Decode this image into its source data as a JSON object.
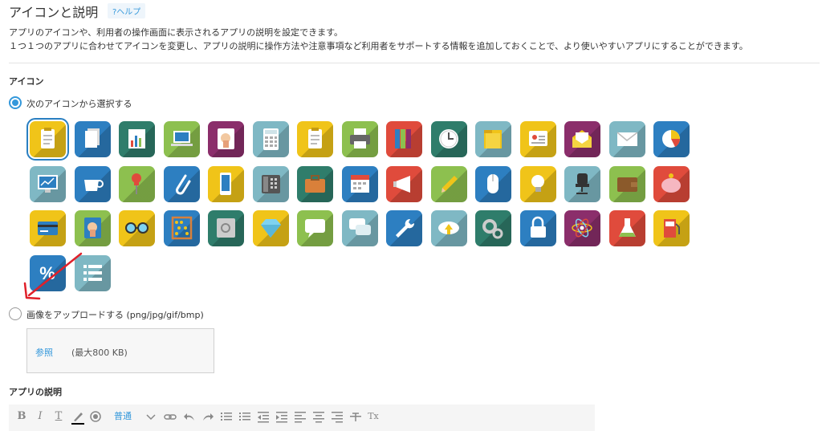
{
  "header": {
    "title": "アイコンと説明",
    "help_label": "?ヘルプ"
  },
  "description": {
    "line1": "アプリのアイコンや、利用者の操作画面に表示されるアプリの説明を設定できます。",
    "line2": "１つ１つのアプリに合わせてアイコンを変更し、アプリの説明に操作方法や注意事項など利用者をサポートする情報を追加しておくことで、より使いやすいアプリにすることができます。"
  },
  "icon_section": {
    "heading": "アイコン",
    "choose_option": "次のアイコンから選択する",
    "upload_option": "画像をアップロードする (png/jpg/gif/bmp)",
    "browse_label": "参照",
    "max_size": "(最大800 KB)",
    "icons": [
      {
        "name": "clipboard-icon",
        "bg": "#f0c419",
        "fg": "#ffffff"
      },
      {
        "name": "documents-icon",
        "bg": "#2d7fc1",
        "fg": "#ffffff"
      },
      {
        "name": "bar-chart-icon",
        "bg": "#2f7d6b",
        "fg": "#ffffff"
      },
      {
        "name": "laptop-icon",
        "bg": "#8dc04f",
        "fg": "#ffffff"
      },
      {
        "name": "hand-card-icon",
        "bg": "#8b2e6b",
        "fg": "#ffffff"
      },
      {
        "name": "calculator-icon",
        "bg": "#7fb8c4",
        "fg": "#ffffff"
      },
      {
        "name": "clipboard-icon",
        "bg": "#f0c419",
        "fg": "#ffffff"
      },
      {
        "name": "printer-icon",
        "bg": "#8dc04f",
        "fg": "#ffffff"
      },
      {
        "name": "binders-icon",
        "bg": "#e04b3c",
        "fg": "#ffffff"
      },
      {
        "name": "clock-icon",
        "bg": "#2f7d6b",
        "fg": "#ffffff"
      },
      {
        "name": "folder-icon",
        "bg": "#7fb8c4",
        "fg": "#f0c419"
      },
      {
        "name": "id-card-icon",
        "bg": "#f0c419",
        "fg": "#ffffff"
      },
      {
        "name": "open-mail-icon",
        "bg": "#8b2e6b",
        "fg": "#ffffff"
      },
      {
        "name": "envelope-icon",
        "bg": "#7fb8c4",
        "fg": "#ffffff"
      },
      {
        "name": "pie-chart-icon",
        "bg": "#2d7fc1",
        "fg": "#ffffff"
      },
      {
        "name": "monitor-icon",
        "bg": "#7fb8c4",
        "fg": "#ffffff"
      },
      {
        "name": "cup-icon",
        "bg": "#2d7fc1",
        "fg": "#ffffff"
      },
      {
        "name": "pushpin-icon",
        "bg": "#8dc04f",
        "fg": "#e04b3c"
      },
      {
        "name": "paperclip-icon",
        "bg": "#2d7fc1",
        "fg": "#ffffff"
      },
      {
        "name": "smartphone-icon",
        "bg": "#f0c419",
        "fg": "#ffffff"
      },
      {
        "name": "phone-icon",
        "bg": "#7fb8c4",
        "fg": "#555555"
      },
      {
        "name": "briefcase-icon",
        "bg": "#2f7d6b",
        "fg": "#d9803a"
      },
      {
        "name": "calendar-icon",
        "bg": "#2d7fc1",
        "fg": "#ffffff"
      },
      {
        "name": "megaphone-icon",
        "bg": "#e04b3c",
        "fg": "#ffffff"
      },
      {
        "name": "pencil-icon",
        "bg": "#8dc04f",
        "fg": "#f0c419"
      },
      {
        "name": "mouse-icon",
        "bg": "#2d7fc1",
        "fg": "#ffffff"
      },
      {
        "name": "light-bulb-icon",
        "bg": "#f0c419",
        "fg": "#ffffff"
      },
      {
        "name": "office-chair-icon",
        "bg": "#7fb8c4",
        "fg": "#333333"
      },
      {
        "name": "wallet-icon",
        "bg": "#8dc04f",
        "fg": "#8b5a2b"
      },
      {
        "name": "piggy-bank-icon",
        "bg": "#e04b3c",
        "fg": "#f6b7c1"
      },
      {
        "name": "credit-card-icon",
        "bg": "#f0c419",
        "fg": "#2d7fc1"
      },
      {
        "name": "hand-card-icon",
        "bg": "#8dc04f",
        "fg": "#2d7fc1"
      },
      {
        "name": "glasses-icon",
        "bg": "#f0c419",
        "fg": "#333333"
      },
      {
        "name": "abacus-icon",
        "bg": "#2d7fc1",
        "fg": "#d9803a"
      },
      {
        "name": "safe-icon",
        "bg": "#2f7d6b",
        "fg": "#cccccc"
      },
      {
        "name": "diamond-icon",
        "bg": "#f0c419",
        "fg": "#7fd3f0"
      },
      {
        "name": "speech-bubble-icon",
        "bg": "#8dc04f",
        "fg": "#ffffff"
      },
      {
        "name": "chat-bubbles-icon",
        "bg": "#7fb8c4",
        "fg": "#ffffff"
      },
      {
        "name": "wrench-icon",
        "bg": "#2d7fc1",
        "fg": "#ffffff"
      },
      {
        "name": "cloud-upload-icon",
        "bg": "#7fb8c4",
        "fg": "#ffffff"
      },
      {
        "name": "gears-icon",
        "bg": "#2f7d6b",
        "fg": "#cccccc"
      },
      {
        "name": "padlock-icon",
        "bg": "#2d7fc1",
        "fg": "#ffffff"
      },
      {
        "name": "atom-icon",
        "bg": "#8b2e6b",
        "fg": "#f0c419"
      },
      {
        "name": "flask-icon",
        "bg": "#e04b3c",
        "fg": "#ffffff"
      },
      {
        "name": "gas-pump-icon",
        "bg": "#f0c419",
        "fg": "#e04b3c"
      },
      {
        "name": "percent-icon",
        "bg": "#2d7fc1",
        "fg": "#ffffff"
      },
      {
        "name": "list-icon",
        "bg": "#7fb8c4",
        "fg": "#ffffff"
      }
    ]
  },
  "description_section": {
    "heading": "アプリの説明"
  },
  "editor_toolbar": {
    "bold": "B",
    "italic": "I",
    "text_format": "T",
    "font_size": "普通",
    "remove_format": "Tx",
    "icons": [
      "bold-icon",
      "italic-icon",
      "text-color-icon",
      "pencil-highlight-icon",
      "background-color-icon",
      "font-size-select",
      "link-icon",
      "undo-icon",
      "redo-icon",
      "unordered-list-icon",
      "ordered-list-icon",
      "outdent-icon",
      "indent-icon",
      "align-left-icon",
      "align-center-icon",
      "align-right-icon",
      "strikethrough-icon",
      "remove-format-icon"
    ]
  },
  "colors": {
    "accent": "#3498db",
    "annotation_arrow": "#e0202a"
  }
}
